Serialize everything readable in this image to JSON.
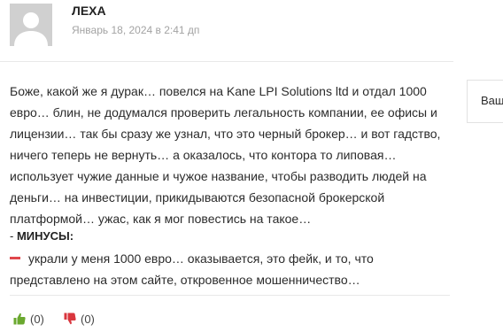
{
  "comment": {
    "author": "ЛЕХА",
    "date": "Январь 18, 2024 в 2:41 дп",
    "text": "Боже, какой же я дурак… повелся на Kane LPI Solutions ltd и отдал 1000 евро… блин, не додумался проверить легальность компании, ее офисы и лицензии… так бы сразу же узнал, что это черный брокер… и вот гадство, ничего теперь не вернуть… а оказалось, что контора то липовая… использует чужие данные и чужое название, чтобы разводить людей на деньги… на инвестиции, прикидываются безопасной брокерской платформой… ужас, как я мог повестись на такое…",
    "cons": {
      "prefix": "- ",
      "title": "МИНУСЫ:",
      "text": "украли у меня 1000 евро… оказывается, это фейк, и то, что представлено на этом сайте, откровенное мошенничество…"
    },
    "votes": {
      "likes": "(0)",
      "dislikes": "(0)"
    }
  },
  "sidebar": {
    "partial_label": "Ваш"
  },
  "colors": {
    "minus_mark": "#e0474c",
    "thumb_up": "#6aa82f",
    "thumb_down": "#d9363e",
    "avatar_bg": "#d0d0d0"
  },
  "icons": {
    "avatar": "default-user-avatar",
    "like": "thumbs-up-icon",
    "dislike": "thumbs-down-icon",
    "cons_bullet": "minus-mark-icon"
  }
}
